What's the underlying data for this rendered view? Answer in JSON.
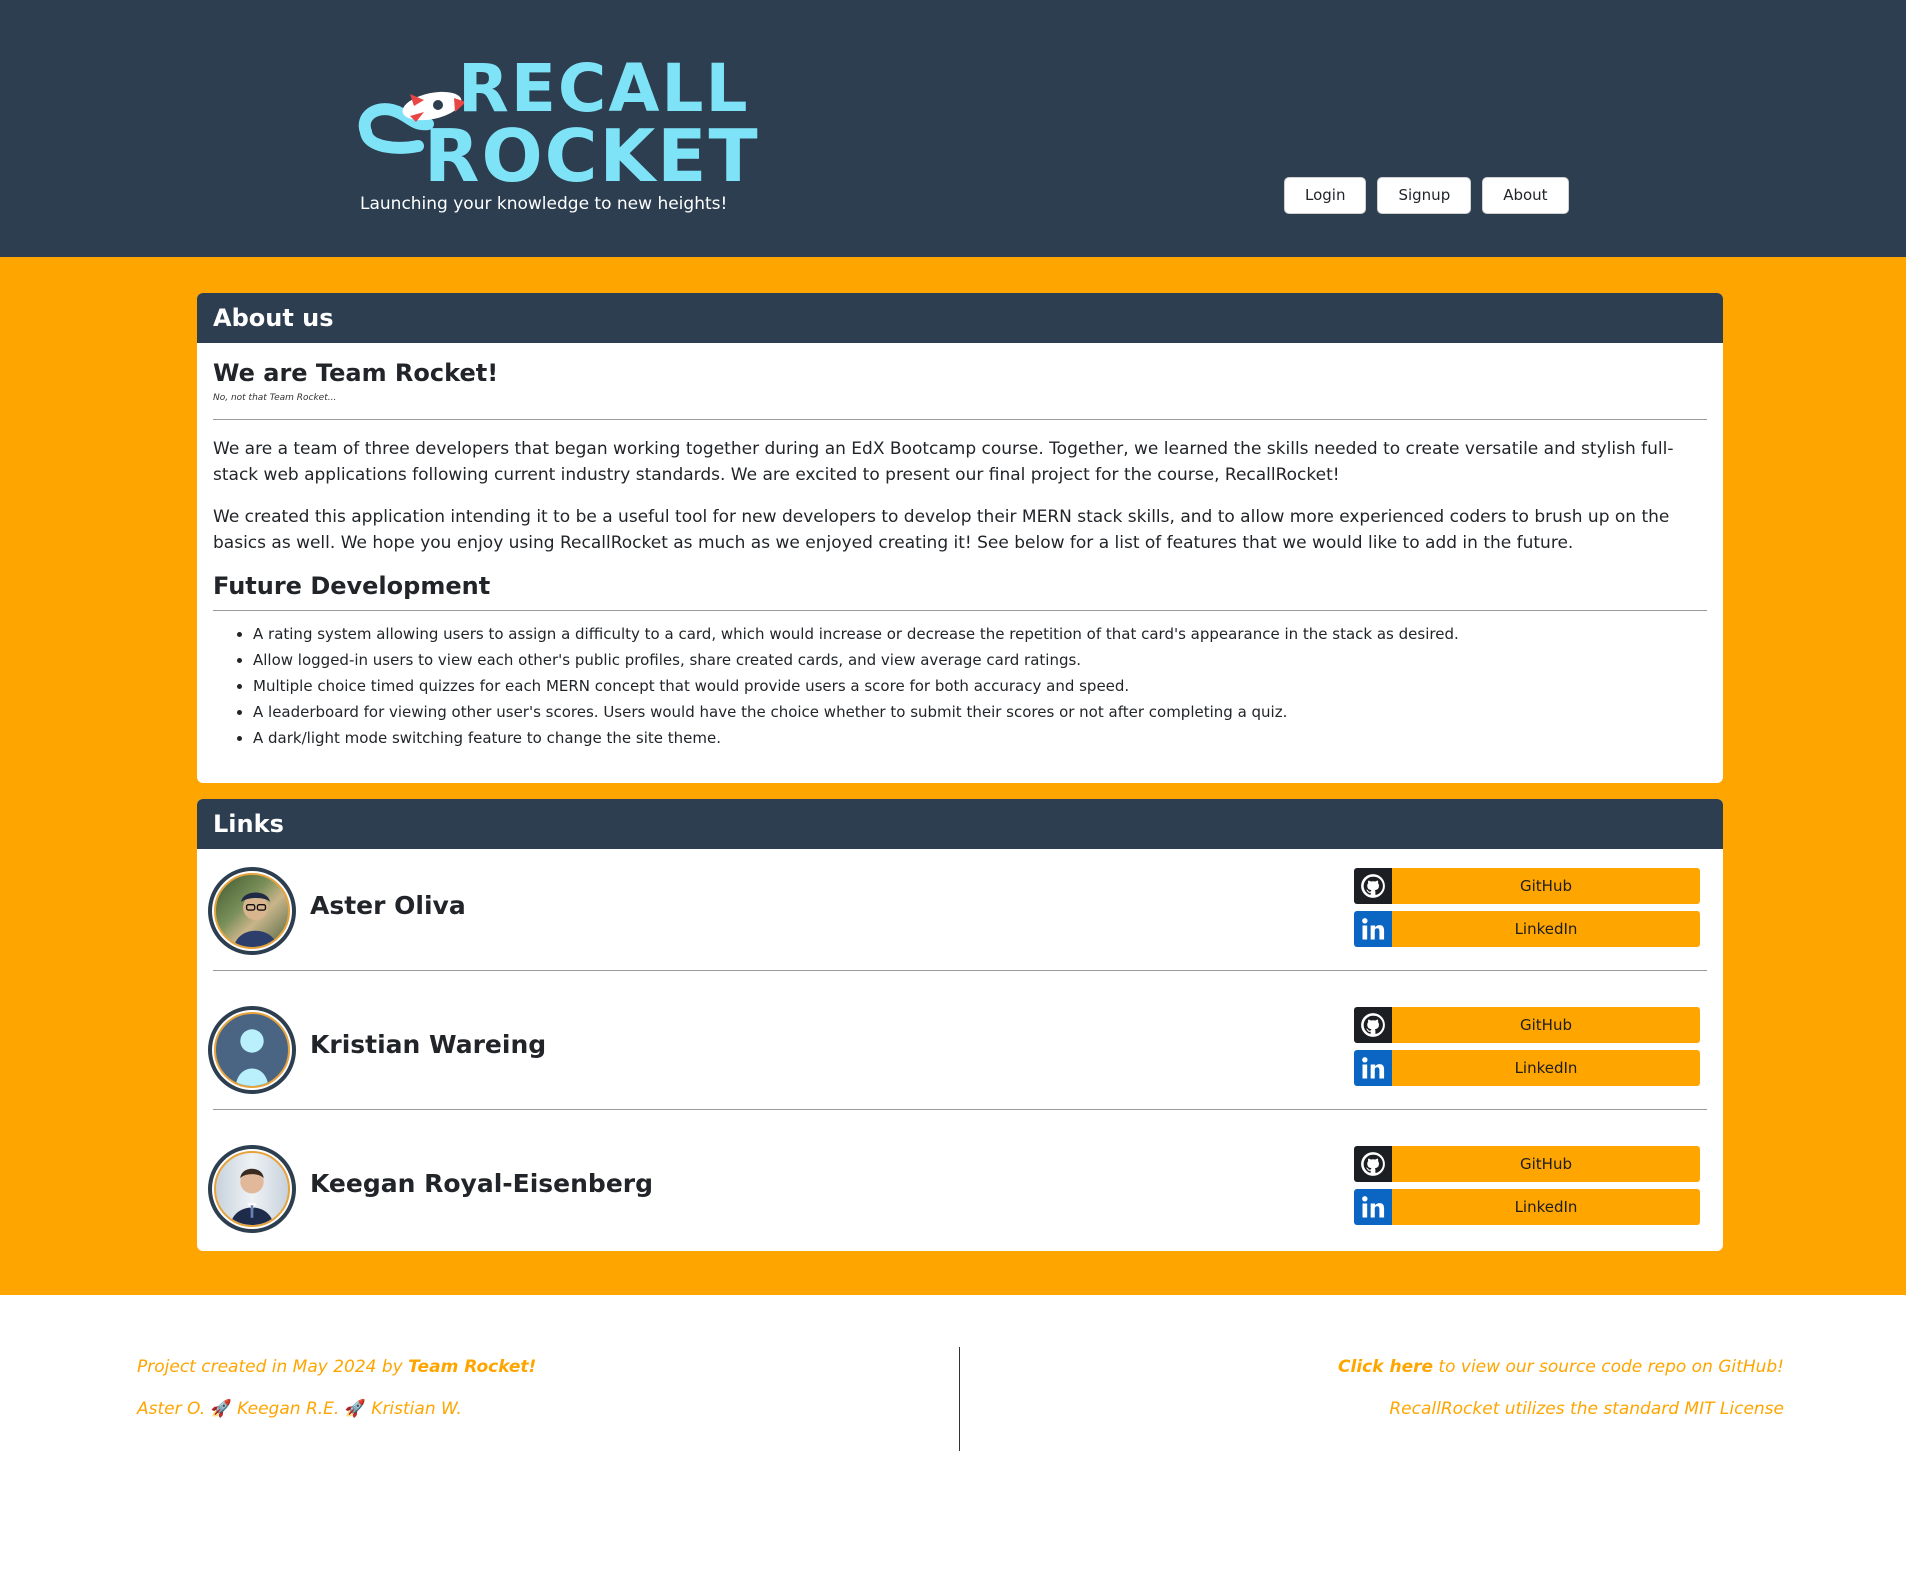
{
  "header": {
    "logo_line1": "RECALL",
    "logo_line2": "ROCKET",
    "tagline": "Launching your knowledge to new heights!",
    "nav": {
      "login": "Login",
      "signup": "Signup",
      "about": "About"
    }
  },
  "about": {
    "heading": "About us",
    "title": "We are Team Rocket!",
    "subtitle": "No, not that Team Rocket...",
    "paragraph1": "We are a team of three developers that began working together during an EdX Bootcamp course. Together, we learned the skills needed to create versatile and stylish full-stack web applications following current industry standards. We are excited to present our final project for the course, RecallRocket!",
    "paragraph2": "We created this application intending it to be a useful tool for new developers to develop their MERN stack skills, and to allow more experienced coders to brush up on the basics as well. We hope you enjoy using RecallRocket as much as we enjoyed creating it! See below for a list of features that we would like to add in the future.",
    "future_title": "Future Development",
    "future_items": [
      "A rating system allowing users to assign a difficulty to a card, which would increase or decrease the repetition of that card's appearance in the stack as desired.",
      "Allow logged-in users to view each other's public profiles, share created cards, and view average card ratings.",
      "Multiple choice timed quizzes for each MERN concept that would provide users a score for both accuracy and speed.",
      "A leaderboard for viewing other user's scores. Users would have the choice whether to submit their scores or not after completing a quiz.",
      "A dark/light mode switching feature to change the site theme."
    ]
  },
  "links": {
    "heading": "Links",
    "people": [
      {
        "name": "Aster Oliva",
        "github": "GitHub",
        "linkedin": "LinkedIn"
      },
      {
        "name": "Kristian Wareing",
        "github": "GitHub",
        "linkedin": "LinkedIn"
      },
      {
        "name": "Keegan Royal-Eisenberg",
        "github": "GitHub",
        "linkedin": "LinkedIn"
      }
    ]
  },
  "footer": {
    "created_prefix": "Project created in May 2024 by ",
    "created_team": "Team Rocket!",
    "member1": "Aster O.",
    "member2": "Keegan R.E.",
    "member3": "Kristian W.",
    "separator_icon": "🚀",
    "repo_link": "Click here",
    "repo_suffix": " to view our source code repo on GitHub!",
    "license": "RecallRocket utilizes the standard MIT License"
  },
  "colors": {
    "navy": "#2c3e50",
    "orange": "#fea500",
    "logo_cyan": "#7fe3f7",
    "linkedin_blue": "#0a66c2",
    "github_black": "#1b1f23"
  },
  "icons": {
    "logo": "rocket-logo",
    "github": "github-icon",
    "linkedin": "linkedin-icon"
  }
}
